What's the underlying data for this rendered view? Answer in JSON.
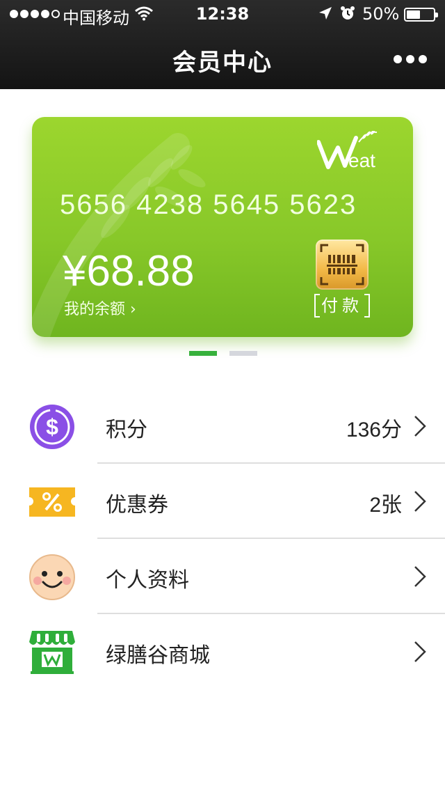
{
  "status_bar": {
    "carrier": "中国移动",
    "time": "12:38",
    "battery": "50%",
    "battery_level": 0.5
  },
  "nav": {
    "title": "会员中心"
  },
  "card": {
    "brand": "Weat",
    "number": "5656 4238 5645 5623",
    "balance": "¥68.88",
    "balance_label": "我的余额 ›",
    "pay_label": "付款",
    "colors": {
      "card": "#8cc82b",
      "pay_button": "#f2b947"
    }
  },
  "pager": {
    "pages": 2,
    "current": 1,
    "active_color": "#37b13c"
  },
  "menu": [
    {
      "label": "积分",
      "value": "136分",
      "icon": "dollar-coin-icon",
      "color": "#8a4fe6"
    },
    {
      "label": "优惠券",
      "value": "2张",
      "icon": "coupon-icon",
      "color": "#f6b621"
    },
    {
      "label": "个人资料",
      "value": "",
      "icon": "smiley-face-icon",
      "color": "#fbd7b4"
    },
    {
      "label": "绿膳谷商城",
      "value": "",
      "icon": "shop-icon",
      "color": "#2fae3a"
    }
  ]
}
